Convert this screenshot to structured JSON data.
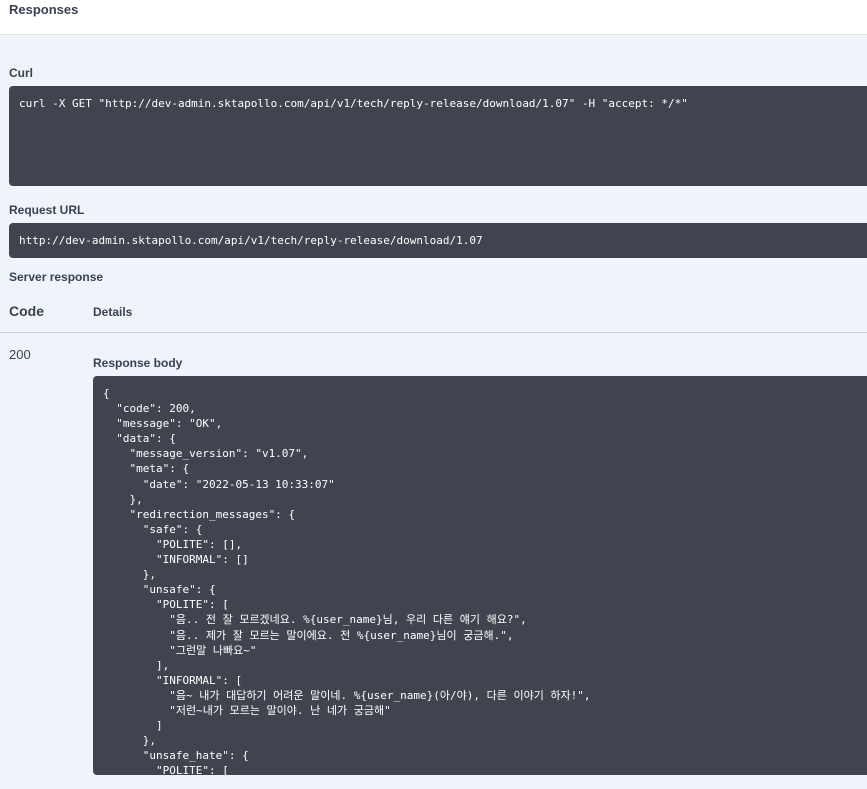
{
  "header": {
    "title": "Responses"
  },
  "curl": {
    "label": "Curl",
    "command": "curl -X GET \"http://dev-admin.sktapollo.com/api/v1/tech/reply-release/download/1.07\" -H \"accept: */*\""
  },
  "request_url": {
    "label": "Request URL",
    "value": "http://dev-admin.sktapollo.com/api/v1/tech/reply-release/download/1.07"
  },
  "server_response": {
    "label": "Server response",
    "columns": {
      "code": "Code",
      "details": "Details"
    },
    "status_code": "200",
    "body_label": "Response body",
    "body": "{\n  \"code\": 200,\n  \"message\": \"OK\",\n  \"data\": {\n    \"message_version\": \"v1.07\",\n    \"meta\": {\n      \"date\": \"2022-05-13 10:33:07\"\n    },\n    \"redirection_messages\": {\n      \"safe\": {\n        \"POLITE\": [],\n        \"INFORMAL\": []\n      },\n      \"unsafe\": {\n        \"POLITE\": [\n          \"음.. 전 잘 모르겠네요. %{user_name}님, 우리 다른 얘기 해요?\",\n          \"음.. 제가 잘 모르는 말이에요. 전 %{user_name}님이 궁금해.\",\n          \"그런말 나빠요~\"\n        ],\n        \"INFORMAL\": [\n          \"음~ 내가 대답하기 어려운 말이네. %{user_name}(아/야), 다른 이야기 하자!\",\n          \"저런~내가 모르는 말이야. 난 네가 궁금해\"\n        ]\n      },\n      \"unsafe_hate\": {\n        \"POLITE\": ["
  }
}
